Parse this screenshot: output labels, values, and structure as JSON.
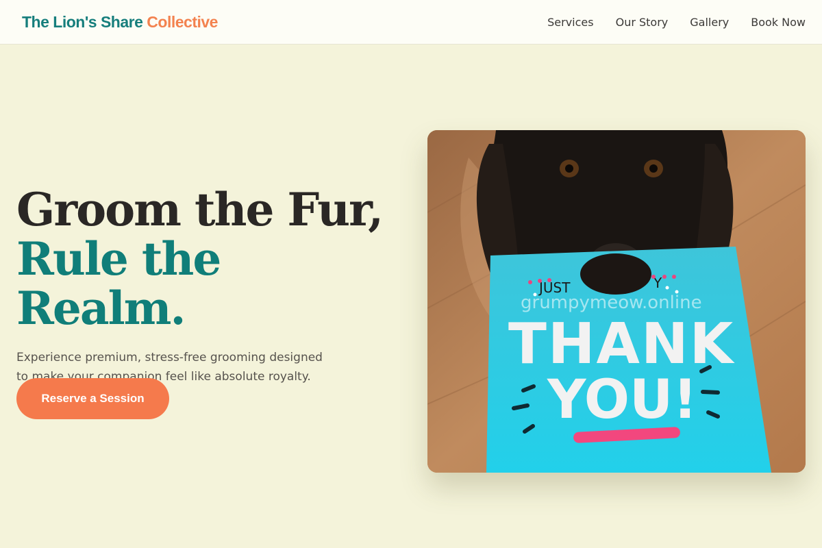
{
  "brand": {
    "part1": "The Lion's Share",
    "part2": "Collective"
  },
  "nav": {
    "items": [
      "Services",
      "Our Story",
      "Gallery",
      "Book Now"
    ]
  },
  "hero": {
    "headline_line1": "Groom the Fur,",
    "headline_line2": "Rule the Realm.",
    "subtitle": "Experience premium, stress-free grooming designed to make your companion feel like absolute royalty.",
    "cta_label": "Reserve a Session"
  },
  "photo": {
    "card_small_text_left": "JUST",
    "card_small_text_right": "Y",
    "card_line1": "THANK",
    "card_line2": "YOU!",
    "watermark": "grumpymeow.online"
  },
  "colors": {
    "background": "#f4f3da",
    "teal": "#107e79",
    "coral": "#f57a4c",
    "card_cyan": "#2bcbe0"
  }
}
